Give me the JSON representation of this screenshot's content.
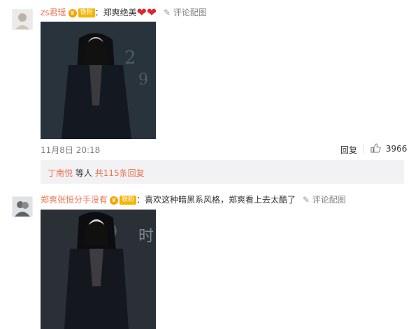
{
  "comments": [
    {
      "username": "zs君瑶",
      "badge": "铁粉",
      "separator": "：",
      "text": "郑爽绝美",
      "emoji": "❤❤",
      "action_pic": "评论配图",
      "date": "11月8日 20:18",
      "reply_label": "回复",
      "like_count": "3966",
      "replies_summary": {
        "user": "丁南悦",
        "middle": "等人",
        "link": "共115条回复"
      }
    },
    {
      "username": "郑爽张恒分手没有",
      "badge": "铁粉",
      "separator": "：",
      "text": "喜欢这种暗黑系风格，郑爽看上去太酷了",
      "action_pic": "评论配图"
    }
  ],
  "icons": {
    "edit": "pen-icon",
    "like": "thumbs-up-icon",
    "vip": "crown-icon"
  },
  "colors": {
    "username": "#eb7350",
    "badge": "#f5b400",
    "heart": "#e0232e",
    "reply_bg": "#f2f2f5"
  }
}
